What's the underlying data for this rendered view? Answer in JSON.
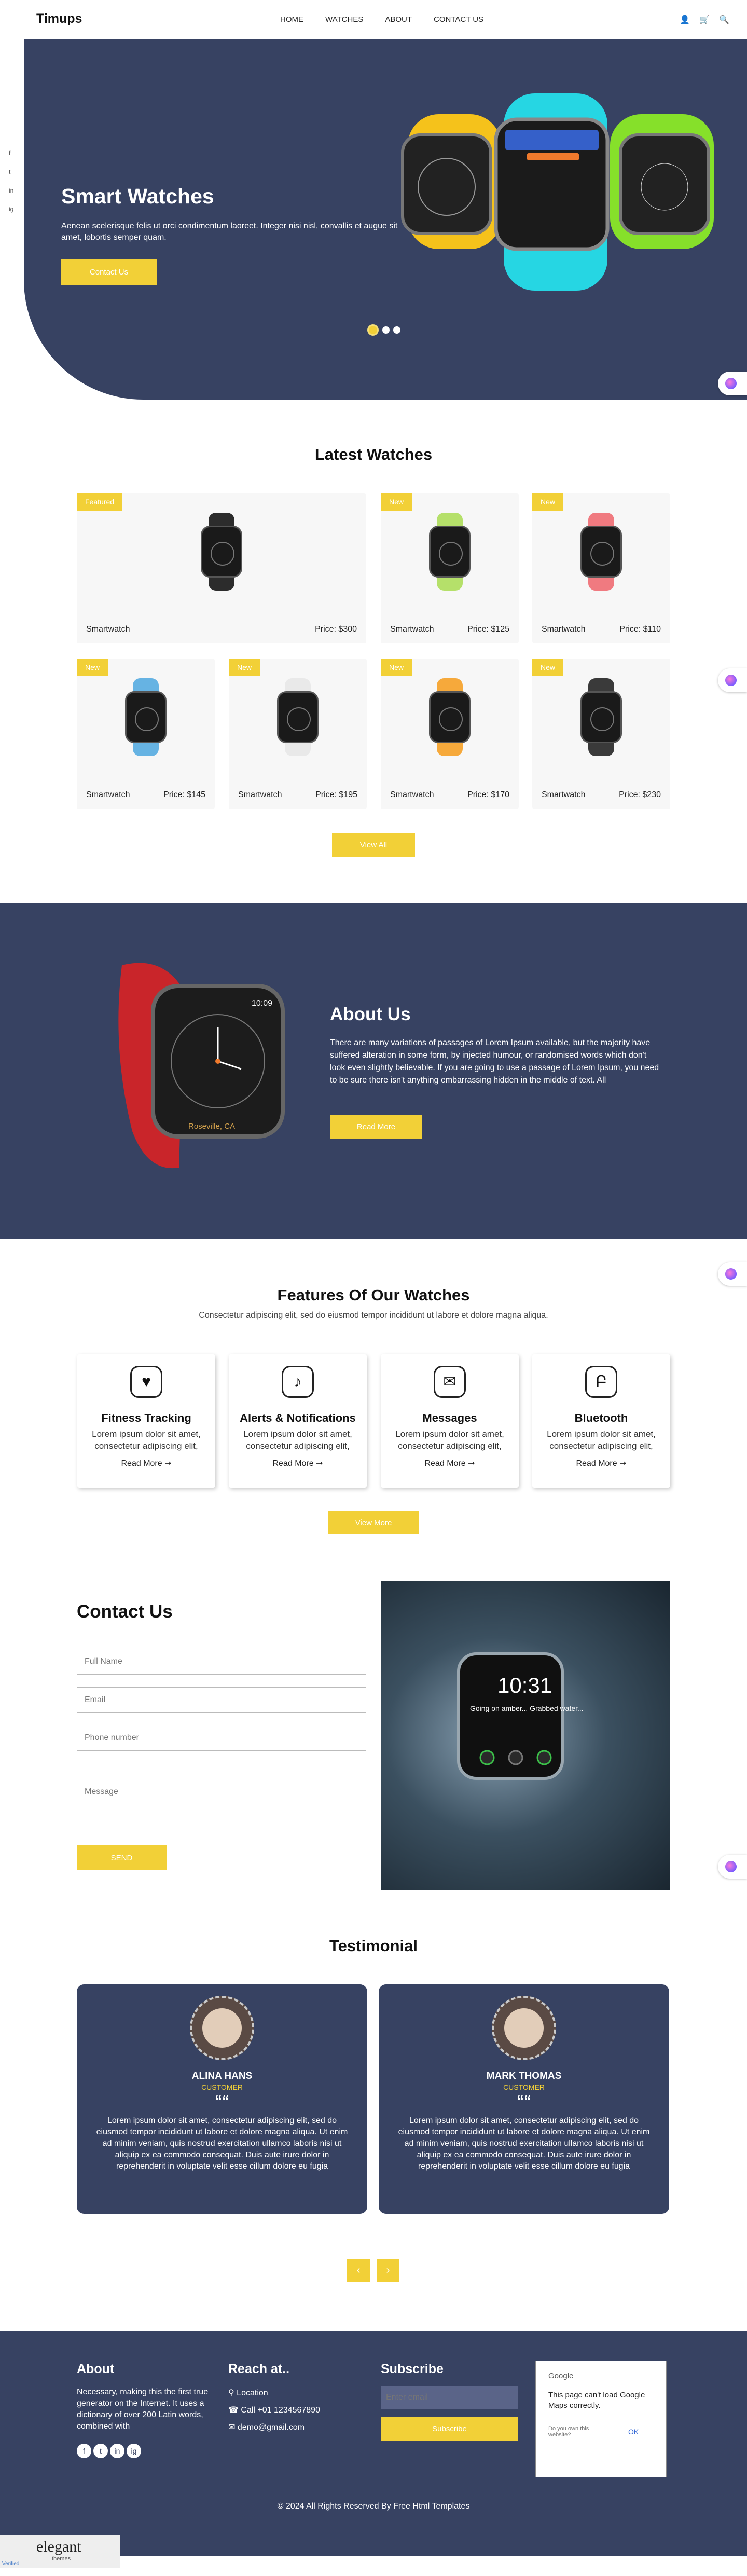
{
  "header": {
    "logo": "Timups",
    "nav": [
      "HOME",
      "WATCHES",
      "ABOUT",
      "CONTACT US"
    ],
    "icons": [
      "user-icon",
      "cart-icon",
      "search-icon"
    ]
  },
  "social_left": [
    "f",
    "t",
    "in",
    "ig"
  ],
  "hero": {
    "title": "Smart Watches",
    "text": "Aenean scelerisque felis ut orci condimentum laoreet. Integer nisi nisl, convallis et augue sit amet, lobortis semper quam.",
    "button": "Contact Us",
    "slides": 3,
    "active_slide": 1
  },
  "latest": {
    "title": "Latest Watches",
    "products": [
      {
        "tag": "Featured",
        "name": "Smartwatch",
        "price": "Price: $300",
        "strap": "#2c2c2c"
      },
      {
        "tag": "New",
        "name": "Smartwatch",
        "price": "Price: $125",
        "strap": "#b5e06a"
      },
      {
        "tag": "New",
        "name": "Smartwatch",
        "price": "Price: $110",
        "strap": "#f07a80"
      },
      {
        "tag": "New",
        "name": "Smartwatch",
        "price": "Price: $145",
        "strap": "#66b3e3"
      },
      {
        "tag": "New",
        "name": "Smartwatch",
        "price": "Price: $195",
        "strap": "#e9e9e9"
      },
      {
        "tag": "New",
        "name": "Smartwatch",
        "price": "Price: $170",
        "strap": "#f6a93b"
      },
      {
        "tag": "New",
        "name": "Smartwatch",
        "price": "Price: $230",
        "strap": "#3a3a3a"
      }
    ],
    "button": "View All"
  },
  "about": {
    "title": "About Us",
    "text": "There are many variations of passages of Lorem Ipsum available, but the majority have suffered alteration in some form, by injected humour, or randomised words which don't look even slightly believable. If you are going to use a passage of Lorem Ipsum, you need to be sure there isn't anything embarrassing hidden in the middle of text. All",
    "button": "Read More",
    "watch_time": "10:09",
    "watch_location": "Roseville, CA"
  },
  "features": {
    "title": "Features Of Our Watches",
    "subtitle": "Consectetur adipiscing elit, sed do eiusmod tempor incididunt ut labore et dolore magna aliqua.",
    "items": [
      {
        "title": "Fitness Tracking",
        "text": "Lorem ipsum dolor sit amet, consectetur adipiscing elit,",
        "link": "Read More ➞",
        "icon": "fitness-watch-icon",
        "glyph": "♥"
      },
      {
        "title": "Alerts & Notifications",
        "text": "Lorem ipsum dolor sit amet, consectetur adipiscing elit,",
        "link": "Read More ➞",
        "icon": "bell-icon",
        "glyph": "♪"
      },
      {
        "title": "Messages",
        "text": "Lorem ipsum dolor sit amet, consectetur adipiscing elit,",
        "link": "Read More ➞",
        "icon": "message-icon",
        "glyph": "✉"
      },
      {
        "title": "Bluetooth",
        "text": "Lorem ipsum dolor sit amet, consectetur adipiscing elit,",
        "link": "Read More ➞",
        "icon": "bluetooth-icon",
        "glyph": "Բ"
      }
    ],
    "button": "View More"
  },
  "contact": {
    "title": "Contact Us",
    "full_name": "Full Name",
    "email": "Email",
    "phone": "Phone number",
    "message": "Message",
    "button": "SEND",
    "watch_time": "10:31",
    "watch_text": "Going on amber... Grabbed water... Meet? Min..."
  },
  "testimonial": {
    "title": "Testimonial",
    "items": [
      {
        "name": "ALINA HANS",
        "role": "CUSTOMER",
        "text": "Lorem ipsum dolor sit amet, consectetur adipiscing elit, sed do eiusmod tempor incididunt ut labore et dolore magna aliqua. Ut enim ad minim veniam, quis nostrud exercitation ullamco laboris nisi ut aliquip ex ea commodo consequat. Duis aute irure dolor in reprehenderit in voluptate velit esse cillum dolore eu fugia"
      },
      {
        "name": "MARK THOMAS",
        "role": "CUSTOMER",
        "text": "Lorem ipsum dolor sit amet, consectetur adipiscing elit, sed do eiusmod tempor incididunt ut labore et dolore magna aliqua. Ut enim ad minim veniam, quis nostrud exercitation ullamco laboris nisi ut aliquip ex ea commodo consequat. Duis aute irure dolor in reprehenderit in voluptate velit esse cillum dolore eu fugia"
      }
    ],
    "prev": "‹",
    "next": "›",
    "quote": "““"
  },
  "footer": {
    "about_title": "About",
    "about_text": "Necessary, making this the first true generator on the Internet. It uses a dictionary of over 200 Latin words, combined with",
    "social": [
      "f",
      "t",
      "in",
      "ig"
    ],
    "reach_title": "Reach at..",
    "location": "Location",
    "phone": "Call +01 1234567890",
    "email": "demo@gmail.com",
    "subscribe_title": "Subscribe",
    "subscribe_placeholder": "Enter email",
    "subscribe_button": "Subscribe",
    "map_brand": "Google",
    "map_error": "This page can't load Google Maps correctly.",
    "map_question": "Do you own this website?",
    "map_ok": "OK",
    "copyright": "© 2024 All Rights Reserved By Free Html Templates"
  },
  "bottom_badge": {
    "brand": "elegant",
    "sub": "themes",
    "caption": "Verified"
  }
}
